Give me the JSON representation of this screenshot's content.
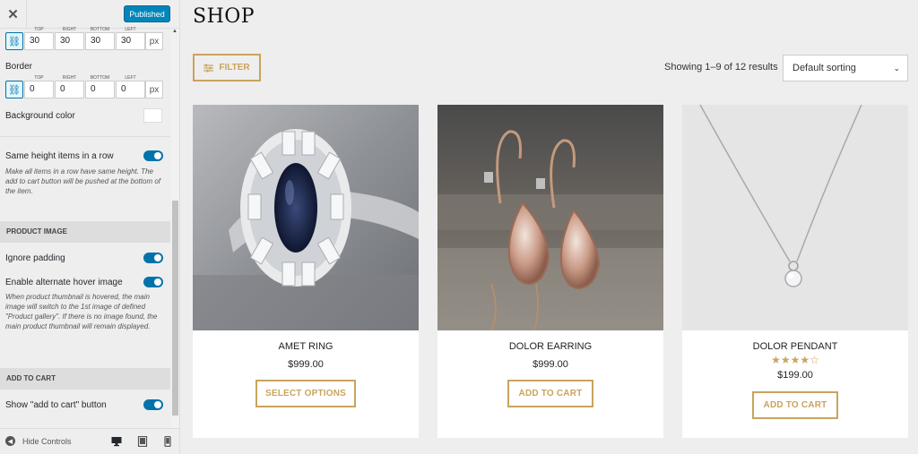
{
  "sidebar": {
    "close_glyph": "✕",
    "publish_label": "Published",
    "padding": {
      "labels": [
        "TOP",
        "RIGHT",
        "BOTTOM",
        "LEFT"
      ],
      "values": [
        "30",
        "30",
        "30",
        "30"
      ],
      "unit": "px"
    },
    "border": {
      "label": "Border",
      "labels": [
        "TOP",
        "RIGHT",
        "BOTTOM",
        "LEFT"
      ],
      "values": [
        "0",
        "0",
        "0",
        "0"
      ],
      "unit": "px"
    },
    "background_color": {
      "label": "Background color",
      "value": "#ffffff"
    },
    "same_height": {
      "label": "Same height items in a row",
      "enabled": true,
      "desc": "Make all items in a row have same height. The add to cart button will be pushed at the bottom of the item."
    },
    "product_image_section": "PRODUCT IMAGE",
    "ignore_padding": {
      "label": "Ignore padding",
      "enabled": true
    },
    "alt_hover": {
      "label": "Enable alternate hover image",
      "enabled": true,
      "desc": "When product thumbnail is hovered, the main image will switch to the 1st image of defined \"Product gallery\". If there is no image found, the main product thumbnail will remain displayed."
    },
    "add_to_cart_section": "ADD TO CART",
    "show_add_to_cart": {
      "label": "Show \"add to cart\" button",
      "enabled": true
    },
    "footer": {
      "hide_controls": "Hide Controls",
      "devices": [
        "desktop-icon",
        "tablet-icon",
        "mobile-icon"
      ]
    }
  },
  "shop": {
    "title": "SHOP",
    "filter_label": "FILTER",
    "result_count": "Showing 1–9 of 12 results",
    "sorting": "Default sorting",
    "accent_color": "#c9a45c",
    "products": [
      {
        "name": "AMET RING",
        "price": "$999.00",
        "button": "SELECT OPTIONS",
        "rating": null
      },
      {
        "name": "DOLOR EARRING",
        "price": "$999.00",
        "button": "ADD TO CART",
        "rating": null
      },
      {
        "name": "DOLOR PENDANT",
        "price": "$199.00",
        "button": "ADD TO CART",
        "rating": 4,
        "stars_text": "★★★★☆"
      }
    ]
  }
}
